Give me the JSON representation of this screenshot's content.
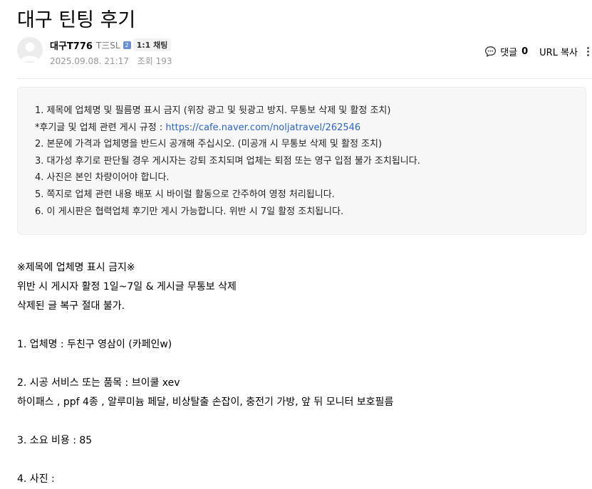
{
  "post": {
    "title": "대구 틴팅 후기"
  },
  "author": {
    "name": "대구T776",
    "level": "T三SL",
    "level_badge": "2",
    "chat_label": "1:1 채팅"
  },
  "meta": {
    "date": "2025.09.08. 21:17",
    "views": "조회 193"
  },
  "actions": {
    "comment_label": "댓글",
    "comment_count": "0",
    "url_copy_label": "URL 복사"
  },
  "notice": {
    "line1": "1. 제목에 업체명 및 필름명 표시 금지 (위장 광고 및 뒷광고 방지. 무통보 삭제 및 활정 조치)",
    "line2_prefix": "*후기글 및 업체 관련 게시 규정 : ",
    "line2_link": "https://cafe.naver.com/noljatravel/262546",
    "line3": "2. 본문에 가격과 업체명을 반드시 공개해 주십시오. (미공개 시 무통보 삭제 및 활정 조치)",
    "line4": "3. 대가성 후기로 판단될 경우 게시자는 강퇴 조치되며 업체는 퇴점 또는 영구 입점 불가 조치됩니다.",
    "line5": "4. 사진은 본인 차량이어야 합니다.",
    "line6": "5. 쪽지로 업체 관련 내용 배포 시 바이럴 활동으로 간주하여 영정 처리됩니다.",
    "line7": "6. 이 게시판은 협력업체 후기만 게시 가능합니다. 위반 시 7일 활정 조치됩니다."
  },
  "content": {
    "line1": "※제목에 업체명 표시 금지※",
    "line2": "위반 시 게시자 활정 1일~7일 & 게시글 무통보 삭제",
    "line3": "삭제된 글 복구 절대 불가.",
    "line4": "1. 업체명 :  두친구 영삼이 (카페인w)",
    "line5": "2. 시공 서비스 또는 품목 :  브이쿨 xev",
    "line6": "하이패스 , ppf 4종 , 알루미늄 페달, 비상탈출 손잡이, 충전기 가방, 앞 뒤 모니터 보호필름",
    "line7": "3. 소요 비용 :  85",
    "line8": "4. 사진 :"
  },
  "colors": {
    "link": "#2b66c6",
    "meta_gray": "#979797",
    "notice_bg": "#f7f7f7",
    "badge_blue": "#6a8fd6"
  },
  "icons": {
    "comment": "speech-bubble-icon",
    "more": "vertical-dots-icon",
    "avatar": "default-avatar-icon"
  }
}
